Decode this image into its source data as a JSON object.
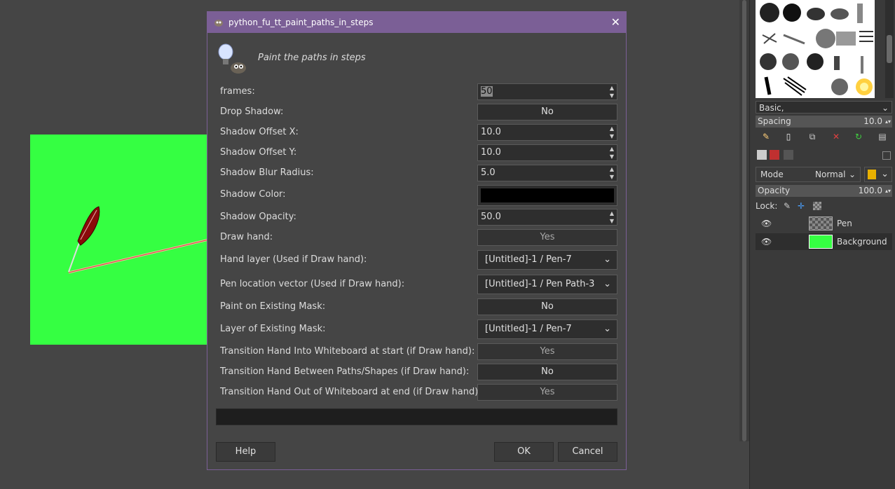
{
  "dialog": {
    "title": "python_fu_tt_paint_paths_in_steps",
    "header_text": "Paint the paths in steps",
    "close_glyph": "✕",
    "fields": {
      "frames": {
        "label": "frames:",
        "value": "50"
      },
      "drop_shadow": {
        "label": "Drop Shadow:",
        "value": "No"
      },
      "shadow_offset_x": {
        "label": "Shadow Offset X:",
        "value": "10.0"
      },
      "shadow_offset_y": {
        "label": "Shadow Offset Y:",
        "value": "10.0"
      },
      "shadow_blur_radius": {
        "label": "Shadow Blur Radius:",
        "value": "5.0"
      },
      "shadow_color": {
        "label": "Shadow Color:",
        "value": "#000000"
      },
      "shadow_opacity": {
        "label": "Shadow Opacity:",
        "value": "50.0"
      },
      "draw_hand": {
        "label": "Draw hand:",
        "value": "Yes"
      },
      "hand_layer": {
        "label": "Hand layer (Used if Draw hand):",
        "value": "[Untitled]-1 / Pen-7"
      },
      "pen_location_vector": {
        "label": "Pen location vector (Used if Draw hand):",
        "value": "[Untitled]-1 / Pen Path-3"
      },
      "paint_on_existing_mask": {
        "label": "Paint on Existing Mask:",
        "value": "No"
      },
      "layer_of_existing_mask": {
        "label": "Layer of Existing Mask:",
        "value": "[Untitled]-1 / Pen-7"
      },
      "transition_in": {
        "label": "Transition Hand Into Whiteboard at start (if Draw hand):",
        "value": "Yes"
      },
      "transition_between": {
        "label": "Transition Hand Between Paths/Shapes (if Draw hand):",
        "value": "No"
      },
      "transition_out": {
        "label": "Transition Hand Out of Whiteboard at end (if Draw hand):",
        "value": "Yes"
      }
    },
    "buttons": {
      "help": "Help",
      "ok": "OK",
      "cancel": "Cancel"
    }
  },
  "dock": {
    "brush_set": "Basic,",
    "spacing": {
      "label": "Spacing",
      "value": "10.0"
    },
    "mode": {
      "label": "Mode",
      "value": "Normal"
    },
    "opacity": {
      "label": "Opacity",
      "value": "100.0"
    },
    "lock_label": "Lock:",
    "layers": [
      {
        "name": "Pen",
        "icon": "eye-icon"
      },
      {
        "name": "Background",
        "icon": "eye-icon"
      }
    ]
  },
  "colors": {
    "accent": "#7b5f96",
    "canvas_fill": "#35ff42",
    "shadow_color": "#000000"
  }
}
